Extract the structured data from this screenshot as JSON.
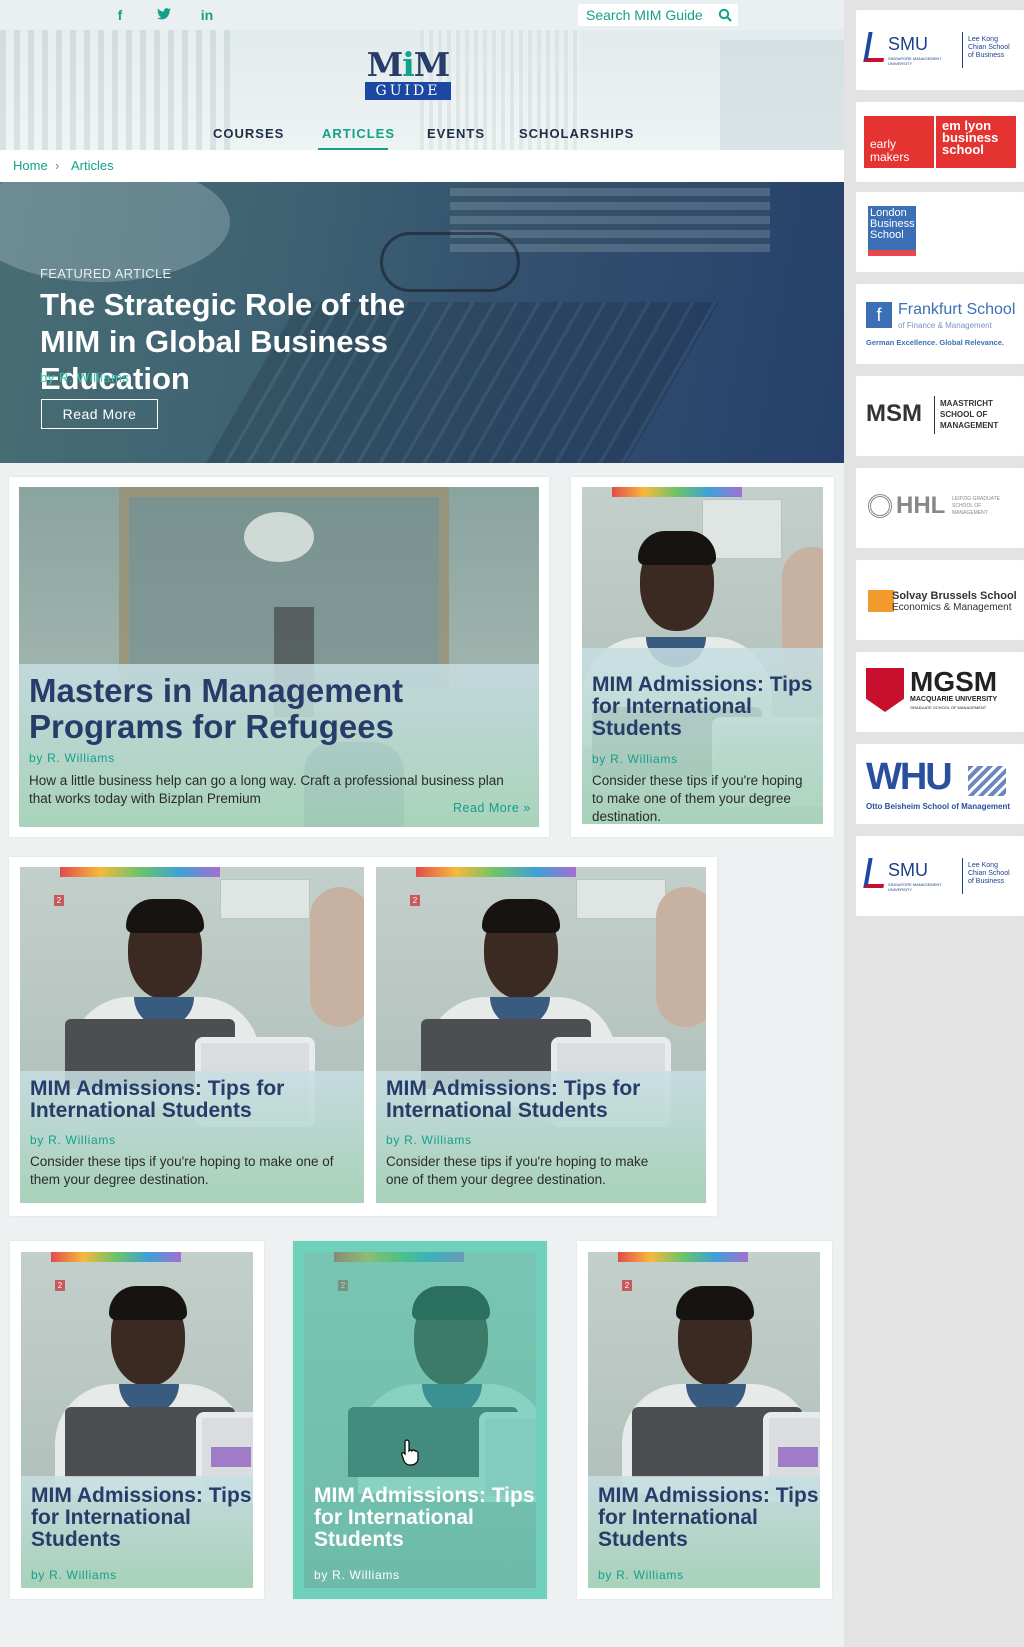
{
  "header": {
    "social": [
      "f",
      "t",
      "in"
    ],
    "search_placeholder": "Search MIM Guide",
    "logo_top": "MiM",
    "logo_bottom": "GUIDE",
    "nav": [
      "COURSES",
      "ARTICLES",
      "EVENTS",
      "SCHOLARSHIPS"
    ],
    "active_nav": "ARTICLES"
  },
  "breadcrumb": {
    "home": "Home",
    "separator": "›",
    "current": "Articles"
  },
  "hero": {
    "label": "FEATURED ARTICLE",
    "title": "The Strategic Role of the MIM in Global Business Education",
    "author": "by R. Williams",
    "button": "Read More"
  },
  "cards": [
    {
      "title": "Masters in Management Programs for Refugees",
      "author": "by R. Williams",
      "description": "How a little business help can go a long way. Craft a professional business plan that works today with Bizplan Premium",
      "link": "Read More »"
    },
    {
      "title": "MIM Admissions: Tips for International Students",
      "author": "by R. Williams",
      "description": "Consider these tips if you're hoping to make one of them your degree destination."
    },
    {
      "title": "MIM Admissions: Tips for International Students",
      "author": "by R. Williams",
      "description": "Consider these tips if you're hoping to make one of them your degree destination."
    },
    {
      "title": "MIM Admissions: Tips for International Students",
      "author": "by R. Williams",
      "description": "Consider these tips if you're hoping to make one of them your degree destination."
    },
    {
      "title": "MIM Admissions: Tips for International Students",
      "author": "by R. Williams"
    },
    {
      "title": "MIM Admissions: Tips for International Students",
      "author": "by R. Williams"
    },
    {
      "title": "MIM Admissions: Tips for International Students",
      "author": "by R. Williams"
    }
  ],
  "sidebar_logos": [
    {
      "name": "SMU",
      "subtitle": "SINGAPORE MANAGEMENT UNIVERSITY",
      "side": "Lee Kong Chian School of Business"
    },
    {
      "left": "early makers",
      "right": "em lyon business school"
    },
    {
      "name": "London Business School"
    },
    {
      "name": "Frankfurt School",
      "subtitle": "of Finance & Management",
      "tagline": "German Excellence. Global Relevance."
    },
    {
      "name": "MSM",
      "subtitle": "MAASTRICHT SCHOOL OF MANAGEMENT"
    },
    {
      "name": "HHL",
      "subtitle": "LEIPZIG GRADUATE SCHOOL OF MANAGEMENT"
    },
    {
      "name": "Solvay Brussels School",
      "subtitle": "Economics & Management"
    },
    {
      "name": "MGSM",
      "subtitle": "MACQUARIE UNIVERSITY",
      "tagline": "GRADUATE SCHOOL OF MANAGEMENT"
    },
    {
      "name": "WHU",
      "subtitle": "Otto Beisheim School of Management"
    },
    {
      "name": "SMU",
      "subtitle": "SINGAPORE MANAGEMENT UNIVERSITY",
      "side": "Lee Kong Chian School of Business"
    }
  ],
  "colors": {
    "teal": "#14a08a",
    "navy": "#263c69",
    "hero_author": "#35c6ac"
  }
}
